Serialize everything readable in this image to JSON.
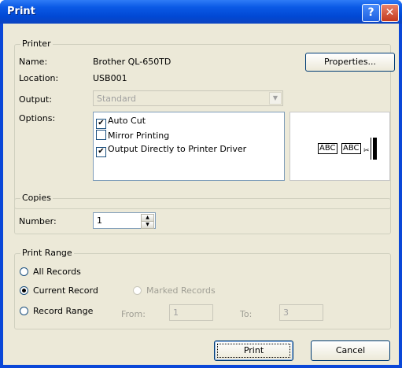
{
  "window": {
    "title": "Print",
    "help_glyph": "?",
    "close_glyph": "✕"
  },
  "printer": {
    "legend": "Printer",
    "name_label": "Name:",
    "name_value": "Brother QL-650TD",
    "location_label": "Location:",
    "location_value": "USB001",
    "output_label": "Output:",
    "output_value": "Standard",
    "options_label": "Options:",
    "properties_label": "Properties...",
    "options": [
      {
        "label": "Auto Cut",
        "checked": true
      },
      {
        "label": "Mirror Printing",
        "checked": false
      },
      {
        "label": "Output Directly to Printer Driver",
        "checked": true
      }
    ],
    "preview": {
      "box1": "ABC",
      "box2": "ABC",
      "cut_mark": "✂"
    }
  },
  "copies": {
    "legend": "Copies",
    "number_label": "Number:",
    "number_value": "1"
  },
  "print_range": {
    "legend": "Print Range",
    "all_records": "All Records",
    "current_record": "Current Record",
    "marked_records": "Marked Records",
    "record_range": "Record Range",
    "from_label": "From:",
    "from_value": "1",
    "to_label": "To:",
    "to_value": "3",
    "selected": "current_record"
  },
  "footer": {
    "print_label": "Print",
    "cancel_label": "Cancel"
  },
  "colors": {
    "title_bar": "#0148d4",
    "dialog_bg": "#ece9d8",
    "field_border": "#7f9db9"
  }
}
